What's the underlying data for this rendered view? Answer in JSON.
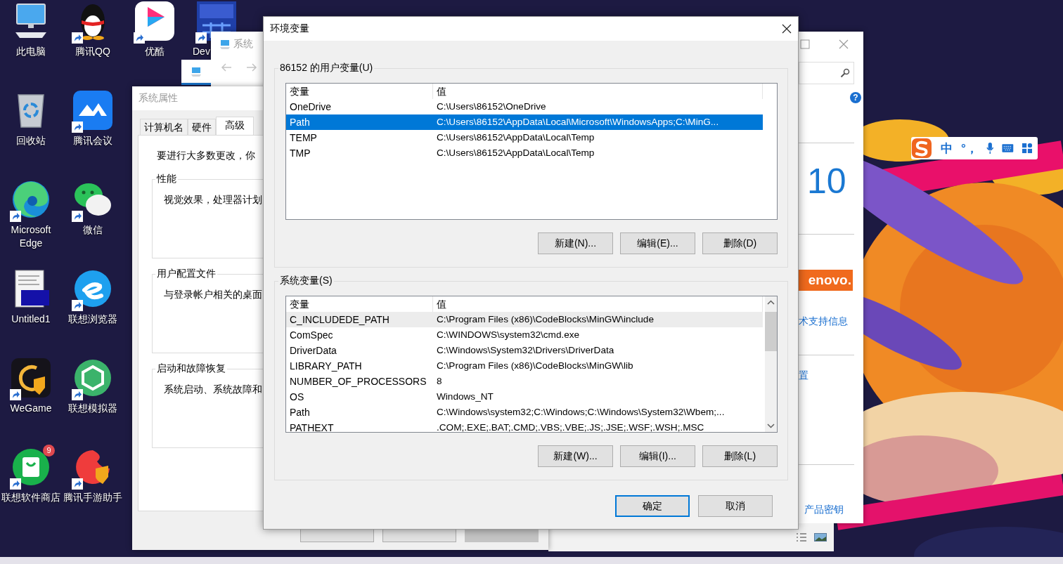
{
  "desktop": {
    "icon_rows": [
      [
        {
          "kind": "computer",
          "label": "此电脑",
          "shortcut": false
        },
        {
          "kind": "penguin",
          "label": "腾讯QQ",
          "shortcut": true
        },
        {
          "kind": "play",
          "label": "优酷",
          "shortcut": true
        },
        {
          "kind": "tile",
          "label": "Dev",
          "shortcut": true
        }
      ],
      [
        {
          "kind": "recycle",
          "label": "回收站",
          "shortcut": false
        },
        {
          "kind": "mountain",
          "label": "腾讯会议",
          "shortcut": true
        }
      ],
      [
        {
          "kind": "swirl",
          "label": "Microsoft Edge",
          "shortcut": true
        },
        {
          "kind": "chat",
          "label": "微信",
          "shortcut": true
        }
      ],
      [
        {
          "kind": "document",
          "label": "Untitled1",
          "shortcut": false
        },
        {
          "kind": "browser",
          "label": "联想浏览器",
          "shortcut": true
        }
      ],
      [
        {
          "kind": "arcgame",
          "label": "WeGame",
          "shortcut": true
        },
        {
          "kind": "cube",
          "label": "联想模拟器",
          "shortcut": true
        }
      ],
      [
        {
          "kind": "bag",
          "label": "联想软件商店",
          "shortcut": true,
          "badge": "9"
        },
        {
          "kind": "redgame",
          "label": "腾讯手游助手",
          "shortcut": true
        }
      ]
    ]
  },
  "system_window": {
    "title": "系统",
    "help": "?",
    "big_number": "10",
    "logo_text": "enovo.",
    "links": [
      "术支持信息",
      "置",
      "产品密钥"
    ]
  },
  "system_properties": {
    "title": "系统属性",
    "tabs": [
      {
        "label": "计算机名",
        "selected": false
      },
      {
        "label": "硬件",
        "selected": false
      },
      {
        "label": "高级",
        "selected": true
      }
    ],
    "intro": "要进行大多数更改，你",
    "groups": [
      {
        "title": "性能",
        "text": "视觉效果，处理器计划"
      },
      {
        "title": "用户配置文件",
        "text": "与登录帐户相关的桌面"
      },
      {
        "title": "启动和故障恢复",
        "text": "系统启动、系统故障和"
      }
    ],
    "buttons": [
      {
        "disabled": false
      },
      {
        "disabled": false
      },
      {
        "disabled": true
      }
    ]
  },
  "env_dialog": {
    "title": "环境变量",
    "groups": [
      {
        "title": "86152 的用户变量(U)",
        "scrollable": false,
        "columns": [
          "变量",
          "值"
        ],
        "rows": [
          {
            "name": "OneDrive",
            "value": "C:\\Users\\86152\\OneDrive",
            "selected": false,
            "hovered": false
          },
          {
            "name": "Path",
            "value": "C:\\Users\\86152\\AppData\\Local\\Microsoft\\WindowsApps;C:\\MinG...",
            "selected": true,
            "hovered": false
          },
          {
            "name": "TEMP",
            "value": "C:\\Users\\86152\\AppData\\Local\\Temp",
            "selected": false,
            "hovered": false
          },
          {
            "name": "TMP",
            "value": "C:\\Users\\86152\\AppData\\Local\\Temp",
            "selected": false,
            "hovered": false
          }
        ],
        "buttons": [
          "新建(N)...",
          "编辑(E)...",
          "删除(D)"
        ]
      },
      {
        "title": "系统变量(S)",
        "scrollable": true,
        "columns": [
          "变量",
          "值"
        ],
        "rows": [
          {
            "name": "C_INCLUDEDE_PATH",
            "value": "C:\\Program Files (x86)\\CodeBlocks\\MinGW\\include",
            "selected": false,
            "hovered": true
          },
          {
            "name": "ComSpec",
            "value": "C:\\WINDOWS\\system32\\cmd.exe",
            "selected": false,
            "hovered": false
          },
          {
            "name": "DriverData",
            "value": "C:\\Windows\\System32\\Drivers\\DriverData",
            "selected": false,
            "hovered": false
          },
          {
            "name": "LIBRARY_PATH",
            "value": "C:\\Program Files (x86)\\CodeBlocks\\MinGW\\lib",
            "selected": false,
            "hovered": false
          },
          {
            "name": "NUMBER_OF_PROCESSORS",
            "value": "8",
            "selected": false,
            "hovered": false
          },
          {
            "name": "OS",
            "value": "Windows_NT",
            "selected": false,
            "hovered": false
          },
          {
            "name": "Path",
            "value": "C:\\Windows\\system32;C:\\Windows;C:\\Windows\\System32\\Wbem;...",
            "selected": false,
            "hovered": false
          },
          {
            "name": "PATHEXT",
            "value": ".COM;.EXE;.BAT;.CMD;.VBS;.VBE;.JS;.JSE;.WSF;.WSH;.MSC",
            "selected": false,
            "hovered": false
          }
        ],
        "buttons": [
          "新建(W)...",
          "编辑(I)...",
          "删除(L)"
        ]
      }
    ],
    "buttons": [
      {
        "label": "确定",
        "default": true
      },
      {
        "label": "取消",
        "default": false
      }
    ]
  },
  "ime_toolbar": {
    "mode": "中",
    "punctuation": "°，"
  }
}
